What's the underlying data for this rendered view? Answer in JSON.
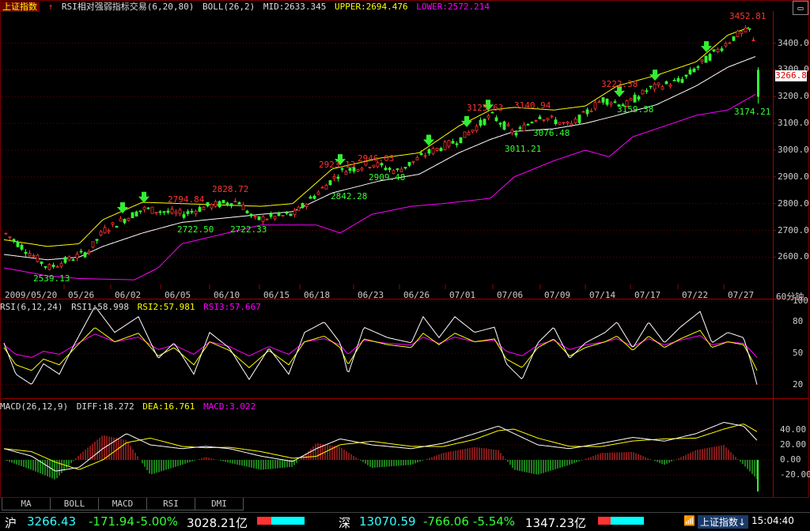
{
  "header": {
    "index_name": "上证指数",
    "indicator": "RSI相对强弱指标交易(6,20,80)",
    "boll": "BOLL(26,2)",
    "mid": "MID:2633.345",
    "upper": "UPPER:2694.476",
    "lower": "LOWER:2572.214"
  },
  "price_axis": {
    "labels": [
      "3400.0",
      "3300.0",
      "3200.0",
      "3100.0",
      "3000.0",
      "2900.0",
      "2800.0",
      "2700.0",
      "2600.0"
    ],
    "values": [
      3400,
      3300,
      3200,
      3100,
      3000,
      2900,
      2800,
      2700,
      2600
    ],
    "current": "3266.8"
  },
  "date_axis": {
    "labels": [
      "2009/05/20",
      "05/26",
      "06/02",
      "06/05",
      "06/10",
      "06/15",
      "06/18",
      "06/23",
      "06/26",
      "07/01",
      "07/06",
      "07/09",
      "07/14",
      "07/17",
      "07/22",
      "07/27"
    ],
    "period": "60分钟"
  },
  "price_labels": [
    {
      "text": "3452.81",
      "kind": "hi"
    },
    {
      "text": "2539.13",
      "kind": "lo"
    },
    {
      "text": "2794.84",
      "kind": "hi"
    },
    {
      "text": "2828.72",
      "kind": "hi"
    },
    {
      "text": "2722.50",
      "kind": "lo"
    },
    {
      "text": "2722.33",
      "kind": "lo"
    },
    {
      "text": "2923.13",
      "kind": "hi"
    },
    {
      "text": "2946.03",
      "kind": "hi"
    },
    {
      "text": "2842.28",
      "kind": "lo"
    },
    {
      "text": "2909.48",
      "kind": "lo"
    },
    {
      "text": "3125.63",
      "kind": "hi"
    },
    {
      "text": "3140.94",
      "kind": "hi"
    },
    {
      "text": "3011.21",
      "kind": "lo"
    },
    {
      "text": "3076.48",
      "kind": "lo"
    },
    {
      "text": "3222.38",
      "kind": "hi"
    },
    {
      "text": "3159.38",
      "kind": "lo"
    },
    {
      "text": "3174.21",
      "kind": "lo"
    }
  ],
  "rsi": {
    "title": "RSI(6,12,24)",
    "rsi1": "RSI1:58.998",
    "rsi2": "RSI2:57.981",
    "rsi3": "RSI3:57.667",
    "labels": [
      "100",
      "80",
      "50",
      "20"
    ]
  },
  "macd": {
    "title": "MACD(26,12,9)",
    "diff": "DIFF:18.272",
    "dea": "DEA:16.761",
    "macd": "MACD:3.022",
    "labels": [
      "40.00",
      "20.00",
      "0.00",
      "-20.00"
    ]
  },
  "tabs": [
    "MA",
    "BOLL",
    "MACD",
    "RSI",
    "DMI"
  ],
  "status": {
    "sh_label": "沪",
    "sh_price": "3266.43",
    "sh_change": "-171.94",
    "sh_pct": "-5.00%",
    "sh_amount": "3028.21亿",
    "sz_label": "深",
    "sz_price": "13070.59",
    "sz_change": "-766.06",
    "sz_pct": "-5.54%",
    "sz_amount": "1347.23亿",
    "index_btn": "上证指数↓",
    "time": "15:04:40"
  },
  "colors": {
    "up": "#ff3333",
    "down": "#33ff33",
    "mid_line": "#ffffff",
    "upper_line": "#ffff00",
    "lower_line": "#ff00ff",
    "arrow": "#33ee33",
    "grid": "#6b0000"
  }
}
